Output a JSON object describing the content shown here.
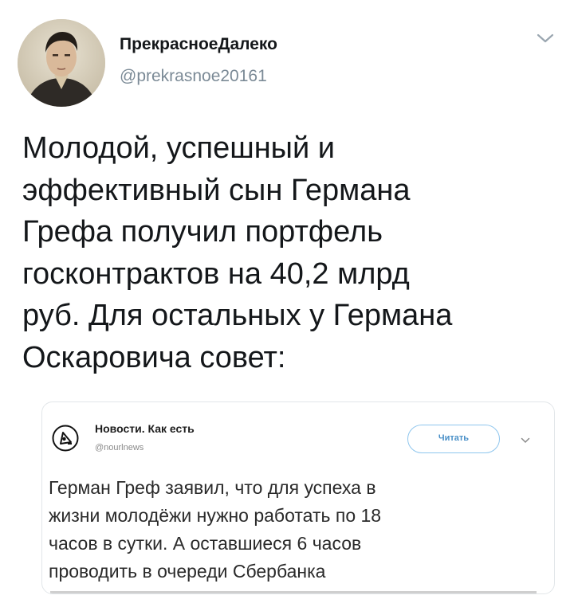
{
  "author": {
    "display_name": "ПрекрасноеДалеко",
    "handle": "@prekrasnoe20161",
    "avatar_icon": "portrait-avatar"
  },
  "tweet": {
    "text_lines": [
      "Молодой, успешный и",
      "эффективный сын Германа",
      "Грефа получил портфель",
      "госконтрактов на 40,2 млрд",
      "руб. Для остальных у Германа",
      "Оскаровича совет:"
    ]
  },
  "quoted": {
    "display_name": "Новости. Как есть",
    "handle": "@nourlnews",
    "follow_label": "Читать",
    "text_lines": [
      "Герман Греф заявил, что для успеха в",
      "жизни молодёжи нужно работать по 18",
      "часов в сутки. А оставшиеся 6 часов",
      "проводить в очереди Сбербанка"
    ]
  },
  "colors": {
    "text": "#14171a",
    "secondary": "#7b8a96",
    "accent": "#4a90c8",
    "border": "#e2e6e9"
  }
}
